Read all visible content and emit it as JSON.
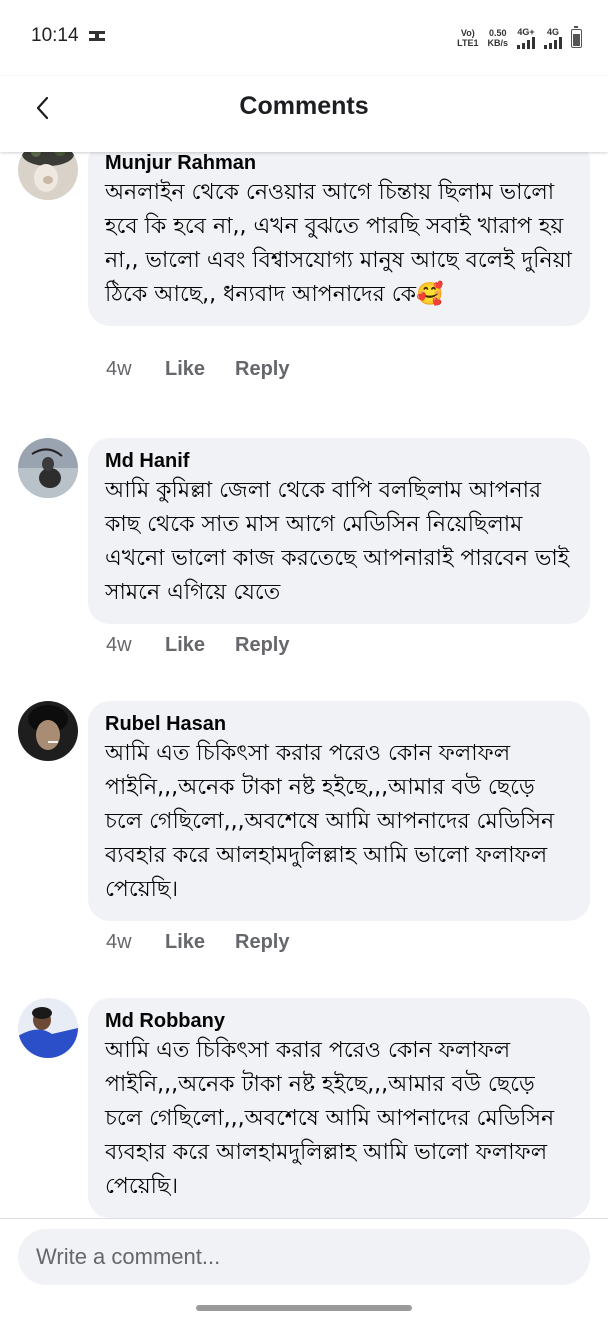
{
  "status_bar": {
    "time": "10:14",
    "net_top": "Vo)",
    "net_bottom": "LTE1",
    "speed_top": "0.50",
    "speed_bottom": "KB/s",
    "sig1_label": "4G+",
    "sig2_label": "4G"
  },
  "header": {
    "title": "Comments",
    "back_icon": "chevron-left-icon"
  },
  "comments": [
    {
      "name": "Munjur Rahman",
      "text": "অনলাইন থেকে নেওয়ার আগে চিন্তায় ছিলাম ভালো হবে কি হবে না,, এখন বুঝতে পারছি সবাই খারাপ হয় না,, ভালো এবং বিশ্বাসযোগ্য মানুষ আছে বলেই দুনিয়া ঠিকে আছে,, ধন্যবাদ আপনাদের কে🥰",
      "time": "4w",
      "like": "Like",
      "reply": "Reply"
    },
    {
      "name": "Md Hanif",
      "text": "আমি কুমিল্লা জেলা থেকে বাপি বলছিলাম আপনার কাছ থেকে সাত মাস আগে মেডিসিন নিয়েছিলাম এখনো ভালো কাজ করতেছে আপনারাই পারবেন ভাই সামনে এগিয়ে যেতে",
      "time": "4w",
      "like": "Like",
      "reply": "Reply"
    },
    {
      "name": "Rubel Hasan",
      "text": "আমি এত চিকিৎসা করার পরেও কোন ফলাফল পাইনি,,,অনেক টাকা নষ্ট হইছে,,,আমার বউ ছেড়ে চলে গেছিলো,,,অবশেষে আমি আপনাদের মেডিসিন ব্যবহার করে আলহামদুলিল্লাহ আমি ভালো ফলাফল পেয়েছি।",
      "time": "4w",
      "like": "Like",
      "reply": "Reply"
    },
    {
      "name": "Md Robbany",
      "text": "আমি এত চিকিৎসা করার পরেও কোন ফলাফল পাইনি,,,অনেক টাকা নষ্ট হইছে,,,আমার বউ ছেড়ে চলে গেছিলো,,,অবশেষে আমি আপনাদের মেডিসিন ব্যবহার করে আলহামদুলিল্লাহ আমি ভালো ফলাফল পেয়েছি।"
    }
  ],
  "composer": {
    "placeholder": "Write a comment..."
  },
  "colors": {
    "bubble": "#f0f2f5",
    "meta_text": "#65676b",
    "name_text": "#050505"
  }
}
